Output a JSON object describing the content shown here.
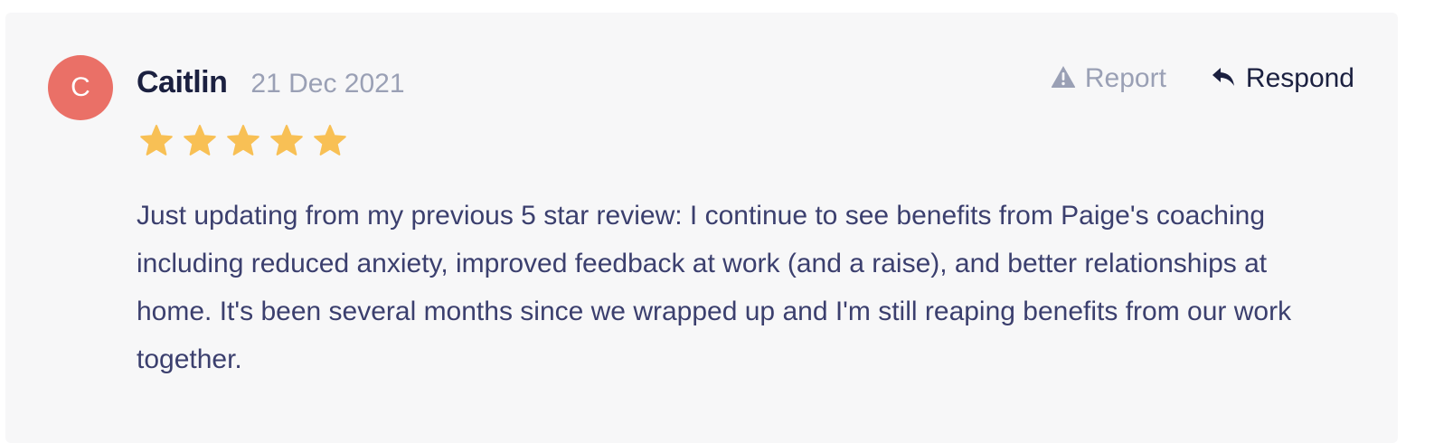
{
  "review": {
    "avatar_initial": "C",
    "author": "Caitlin",
    "date": "21 Dec 2021",
    "rating": 5,
    "rating_max": 5,
    "body": "Just updating from my previous 5 star review: I continue to see benefits from Paige's coaching including reduced anxiety, improved feedback at work (and a raise), and better relationships at home. It's been several months since we wrapped up and I'm still reaping benefits from our work together."
  },
  "actions": {
    "report_label": "Report",
    "respond_label": "Respond"
  },
  "icons": {
    "report": "warning-triangle-icon",
    "respond": "reply-arrow-icon",
    "star": "star-icon"
  },
  "colors": {
    "avatar_bg": "#ea7067",
    "star": "#f8c055",
    "author": "#1b2040",
    "muted": "#9aa0b5",
    "body_text": "#3b3f6e",
    "card_bg": "#f7f7f8"
  }
}
